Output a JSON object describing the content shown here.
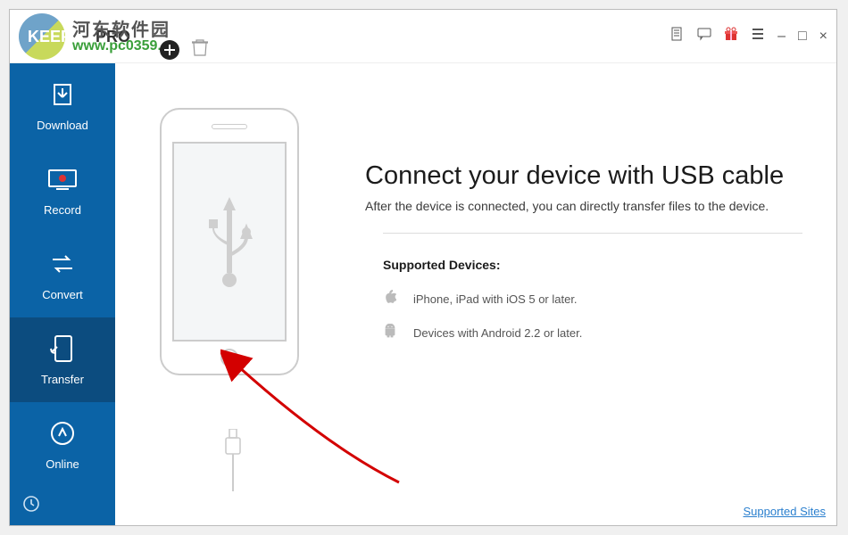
{
  "watermark": {
    "brand": "河东软件园",
    "url": "www.pc0359.cn"
  },
  "logo": {
    "name": "KEEPVID",
    "suffix": "PRO"
  },
  "titlebar": {
    "add_button_icon": "plus",
    "trash_icon": "trash"
  },
  "window_controls": {
    "doc_icon": "document",
    "chat_icon": "chat",
    "gift_icon": "gift",
    "menu_icon": "menu",
    "minimize": "–",
    "maximize": "□",
    "close": "×"
  },
  "sidebar": {
    "items": [
      {
        "key": "download",
        "label": "Download"
      },
      {
        "key": "record",
        "label": "Record"
      },
      {
        "key": "convert",
        "label": "Convert"
      },
      {
        "key": "transfer",
        "label": "Transfer"
      },
      {
        "key": "online",
        "label": "Online"
      }
    ],
    "active_index": 3,
    "bottom_icon": "clock"
  },
  "content": {
    "headline": "Connect your device with USB cable",
    "subhead": "After the device is connected, you can directly transfer files to the device.",
    "supported_title": "Supported Devices:",
    "devices": [
      {
        "platform": "apple",
        "text": "iPhone, iPad with iOS 5 or later."
      },
      {
        "platform": "android",
        "text": "Devices with Android 2.2 or later."
      }
    ],
    "supported_link": "Supported Sites"
  }
}
